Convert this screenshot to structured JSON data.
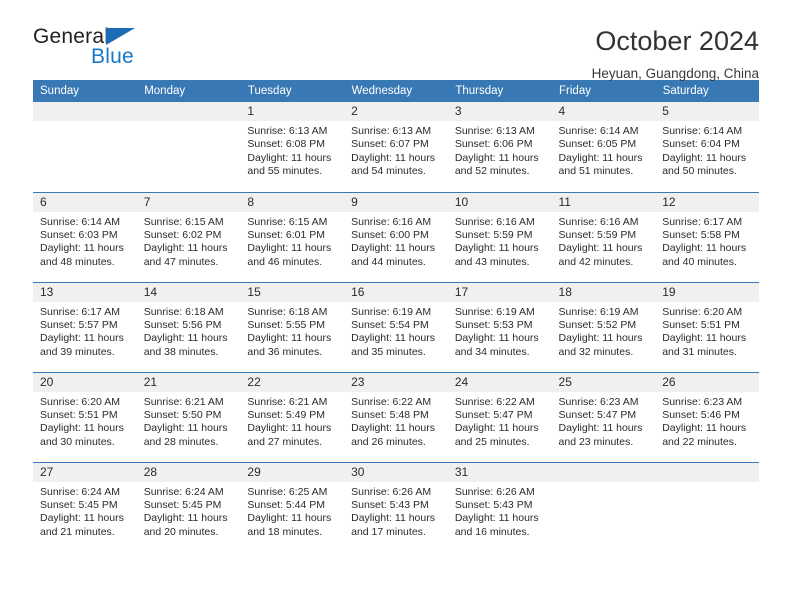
{
  "brand": {
    "name_top": "General",
    "name_bottom": "Blue",
    "accent_color": "#1878c8",
    "triangle_color": "#1c6cb5"
  },
  "header": {
    "title": "October 2024",
    "location": "Heyuan, Guangdong, China"
  },
  "theme": {
    "header_blue": "#3878b4",
    "daynum_bg": "#f0f0f0",
    "text": "#2b2b2b"
  },
  "weekdays": [
    "Sunday",
    "Monday",
    "Tuesday",
    "Wednesday",
    "Thursday",
    "Friday",
    "Saturday"
  ],
  "labels": {
    "sunrise": "Sunrise:",
    "sunset": "Sunset:",
    "daylight": "Daylight:"
  },
  "weeks": [
    [
      {
        "day": "",
        "sunrise": "",
        "sunset": "",
        "daylight": ""
      },
      {
        "day": "",
        "sunrise": "",
        "sunset": "",
        "daylight": ""
      },
      {
        "day": "1",
        "sunrise": "Sunrise: 6:13 AM",
        "sunset": "Sunset: 6:08 PM",
        "daylight": "Daylight: 11 hours and 55 minutes."
      },
      {
        "day": "2",
        "sunrise": "Sunrise: 6:13 AM",
        "sunset": "Sunset: 6:07 PM",
        "daylight": "Daylight: 11 hours and 54 minutes."
      },
      {
        "day": "3",
        "sunrise": "Sunrise: 6:13 AM",
        "sunset": "Sunset: 6:06 PM",
        "daylight": "Daylight: 11 hours and 52 minutes."
      },
      {
        "day": "4",
        "sunrise": "Sunrise: 6:14 AM",
        "sunset": "Sunset: 6:05 PM",
        "daylight": "Daylight: 11 hours and 51 minutes."
      },
      {
        "day": "5",
        "sunrise": "Sunrise: 6:14 AM",
        "sunset": "Sunset: 6:04 PM",
        "daylight": "Daylight: 11 hours and 50 minutes."
      }
    ],
    [
      {
        "day": "6",
        "sunrise": "Sunrise: 6:14 AM",
        "sunset": "Sunset: 6:03 PM",
        "daylight": "Daylight: 11 hours and 48 minutes."
      },
      {
        "day": "7",
        "sunrise": "Sunrise: 6:15 AM",
        "sunset": "Sunset: 6:02 PM",
        "daylight": "Daylight: 11 hours and 47 minutes."
      },
      {
        "day": "8",
        "sunrise": "Sunrise: 6:15 AM",
        "sunset": "Sunset: 6:01 PM",
        "daylight": "Daylight: 11 hours and 46 minutes."
      },
      {
        "day": "9",
        "sunrise": "Sunrise: 6:16 AM",
        "sunset": "Sunset: 6:00 PM",
        "daylight": "Daylight: 11 hours and 44 minutes."
      },
      {
        "day": "10",
        "sunrise": "Sunrise: 6:16 AM",
        "sunset": "Sunset: 5:59 PM",
        "daylight": "Daylight: 11 hours and 43 minutes."
      },
      {
        "day": "11",
        "sunrise": "Sunrise: 6:16 AM",
        "sunset": "Sunset: 5:59 PM",
        "daylight": "Daylight: 11 hours and 42 minutes."
      },
      {
        "day": "12",
        "sunrise": "Sunrise: 6:17 AM",
        "sunset": "Sunset: 5:58 PM",
        "daylight": "Daylight: 11 hours and 40 minutes."
      }
    ],
    [
      {
        "day": "13",
        "sunrise": "Sunrise: 6:17 AM",
        "sunset": "Sunset: 5:57 PM",
        "daylight": "Daylight: 11 hours and 39 minutes."
      },
      {
        "day": "14",
        "sunrise": "Sunrise: 6:18 AM",
        "sunset": "Sunset: 5:56 PM",
        "daylight": "Daylight: 11 hours and 38 minutes."
      },
      {
        "day": "15",
        "sunrise": "Sunrise: 6:18 AM",
        "sunset": "Sunset: 5:55 PM",
        "daylight": "Daylight: 11 hours and 36 minutes."
      },
      {
        "day": "16",
        "sunrise": "Sunrise: 6:19 AM",
        "sunset": "Sunset: 5:54 PM",
        "daylight": "Daylight: 11 hours and 35 minutes."
      },
      {
        "day": "17",
        "sunrise": "Sunrise: 6:19 AM",
        "sunset": "Sunset: 5:53 PM",
        "daylight": "Daylight: 11 hours and 34 minutes."
      },
      {
        "day": "18",
        "sunrise": "Sunrise: 6:19 AM",
        "sunset": "Sunset: 5:52 PM",
        "daylight": "Daylight: 11 hours and 32 minutes."
      },
      {
        "day": "19",
        "sunrise": "Sunrise: 6:20 AM",
        "sunset": "Sunset: 5:51 PM",
        "daylight": "Daylight: 11 hours and 31 minutes."
      }
    ],
    [
      {
        "day": "20",
        "sunrise": "Sunrise: 6:20 AM",
        "sunset": "Sunset: 5:51 PM",
        "daylight": "Daylight: 11 hours and 30 minutes."
      },
      {
        "day": "21",
        "sunrise": "Sunrise: 6:21 AM",
        "sunset": "Sunset: 5:50 PM",
        "daylight": "Daylight: 11 hours and 28 minutes."
      },
      {
        "day": "22",
        "sunrise": "Sunrise: 6:21 AM",
        "sunset": "Sunset: 5:49 PM",
        "daylight": "Daylight: 11 hours and 27 minutes."
      },
      {
        "day": "23",
        "sunrise": "Sunrise: 6:22 AM",
        "sunset": "Sunset: 5:48 PM",
        "daylight": "Daylight: 11 hours and 26 minutes."
      },
      {
        "day": "24",
        "sunrise": "Sunrise: 6:22 AM",
        "sunset": "Sunset: 5:47 PM",
        "daylight": "Daylight: 11 hours and 25 minutes."
      },
      {
        "day": "25",
        "sunrise": "Sunrise: 6:23 AM",
        "sunset": "Sunset: 5:47 PM",
        "daylight": "Daylight: 11 hours and 23 minutes."
      },
      {
        "day": "26",
        "sunrise": "Sunrise: 6:23 AM",
        "sunset": "Sunset: 5:46 PM",
        "daylight": "Daylight: 11 hours and 22 minutes."
      }
    ],
    [
      {
        "day": "27",
        "sunrise": "Sunrise: 6:24 AM",
        "sunset": "Sunset: 5:45 PM",
        "daylight": "Daylight: 11 hours and 21 minutes."
      },
      {
        "day": "28",
        "sunrise": "Sunrise: 6:24 AM",
        "sunset": "Sunset: 5:45 PM",
        "daylight": "Daylight: 11 hours and 20 minutes."
      },
      {
        "day": "29",
        "sunrise": "Sunrise: 6:25 AM",
        "sunset": "Sunset: 5:44 PM",
        "daylight": "Daylight: 11 hours and 18 minutes."
      },
      {
        "day": "30",
        "sunrise": "Sunrise: 6:26 AM",
        "sunset": "Sunset: 5:43 PM",
        "daylight": "Daylight: 11 hours and 17 minutes."
      },
      {
        "day": "31",
        "sunrise": "Sunrise: 6:26 AM",
        "sunset": "Sunset: 5:43 PM",
        "daylight": "Daylight: 11 hours and 16 minutes."
      },
      {
        "day": "",
        "sunrise": "",
        "sunset": "",
        "daylight": ""
      },
      {
        "day": "",
        "sunrise": "",
        "sunset": "",
        "daylight": ""
      }
    ]
  ]
}
